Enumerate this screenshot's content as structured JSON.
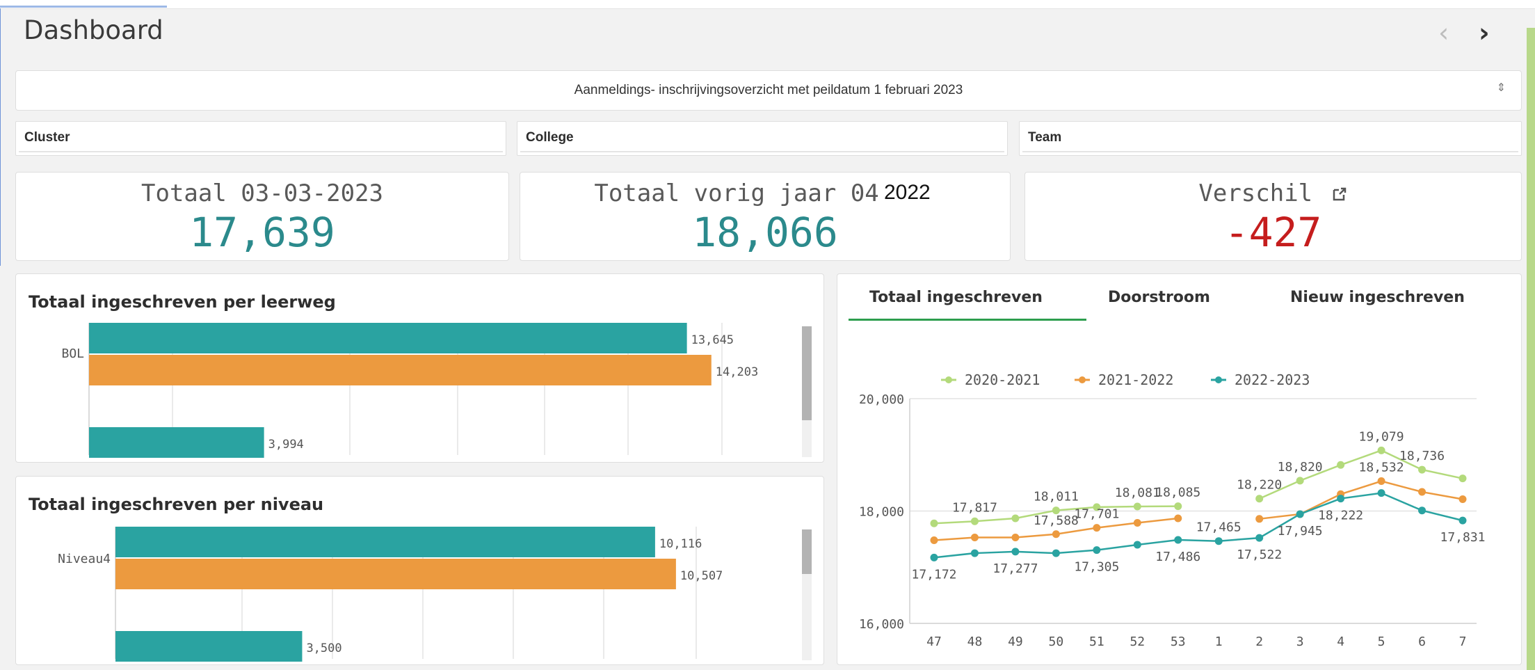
{
  "header": {
    "title": "Dashboard",
    "prev_icon": "‹",
    "next_icon": "›"
  },
  "sheet_selector": {
    "label": "Aanmeldings- inschrijvingsoverzicht met peildatum 1 februari 2023",
    "spin_icon": "⇕"
  },
  "filters": [
    {
      "label": "Cluster"
    },
    {
      "label": "College"
    },
    {
      "label": "Team"
    }
  ],
  "kpis": [
    {
      "title": "Totaal 03-03-2023",
      "value": "17,639"
    },
    {
      "title": "Totaal vorig jaar 04-03-",
      "value": "18,066",
      "overlay": "2022"
    },
    {
      "title": "Verschil",
      "value": "-427",
      "icon": "external-link-icon"
    }
  ],
  "colors": {
    "teal": "#2aa3a1",
    "orange": "#ec9a3f",
    "lightgreen": "#b3da7b",
    "negative": "#c51d1d",
    "accent": "#2d9e4e"
  },
  "bar_leerweg": {
    "title": "Totaal ingeschreven per leerweg",
    "category": "BOL",
    "bars": [
      {
        "label": "13,645",
        "value": 13645,
        "color": "#2aa3a1"
      },
      {
        "label": "14,203",
        "value": 14203,
        "color": "#ec9a3f"
      },
      {
        "label": "3,994",
        "value": 3994,
        "color": "#2aa3a1"
      }
    ]
  },
  "bar_niveau": {
    "title": "Totaal ingeschreven per niveau",
    "category": "Niveau4",
    "bars": [
      {
        "label": "10,116",
        "value": 10116,
        "color": "#2aa3a1"
      },
      {
        "label": "10,507",
        "value": 10507,
        "color": "#ec9a3f"
      },
      {
        "label": "3,500",
        "value": 3500,
        "color": "#2aa3a1"
      }
    ]
  },
  "tabs": [
    {
      "label": "Totaal ingeschreven",
      "active": true
    },
    {
      "label": "Doorstroom",
      "active": false
    },
    {
      "label": "Nieuw ingeschreven",
      "active": false
    }
  ],
  "chart_data": {
    "type": "line",
    "categories": [
      "47",
      "48",
      "49",
      "50",
      "51",
      "52",
      "53",
      "1",
      "2",
      "3",
      "4",
      "5",
      "6",
      "7"
    ],
    "ylim": [
      16000,
      20000
    ],
    "yticks": [
      "16,000",
      "18,000",
      "20,000"
    ],
    "legend_position": "top",
    "series": [
      {
        "name": "2020-2021",
        "color": "#b3da7b",
        "values": [
          17780,
          17817,
          17870,
          18011,
          18070,
          18081,
          18085,
          null,
          18220,
          18540,
          18820,
          19079,
          18736,
          18580
        ]
      },
      {
        "name": "2021-2022",
        "color": "#ec9a3f",
        "values": [
          17480,
          17530,
          17530,
          17588,
          17701,
          17790,
          17870,
          null,
          17860,
          17945,
          18300,
          18532,
          18340,
          18210
        ]
      },
      {
        "name": "2022-2023",
        "color": "#2aa3a1",
        "values": [
          17172,
          17250,
          17277,
          17250,
          17305,
          17400,
          17486,
          17465,
          17522,
          17945,
          18222,
          18320,
          18010,
          17831
        ]
      }
    ],
    "annotations": [
      {
        "series": 2,
        "index": 0,
        "label": "17,172",
        "pos": "below"
      },
      {
        "series": 0,
        "index": 1,
        "label": "17,817",
        "pos": "above"
      },
      {
        "series": 2,
        "index": 2,
        "label": "17,277",
        "pos": "below"
      },
      {
        "series": 1,
        "index": 3,
        "label": "17,588",
        "pos": "above"
      },
      {
        "series": 0,
        "index": 3,
        "label": "18,011",
        "pos": "above"
      },
      {
        "series": 1,
        "index": 4,
        "label": "17,701",
        "pos": "above"
      },
      {
        "series": 2,
        "index": 4,
        "label": "17,305",
        "pos": "below"
      },
      {
        "series": 0,
        "index": 5,
        "label": "18,081",
        "pos": "above"
      },
      {
        "series": 0,
        "index": 6,
        "label": "18,085",
        "pos": "above"
      },
      {
        "series": 2,
        "index": 6,
        "label": "17,486",
        "pos": "below"
      },
      {
        "series": 2,
        "index": 7,
        "label": "17,465",
        "pos": "above"
      },
      {
        "series": 0,
        "index": 8,
        "label": "18,220",
        "pos": "above"
      },
      {
        "series": 2,
        "index": 8,
        "label": "17,522",
        "pos": "below"
      },
      {
        "series": 1,
        "index": 9,
        "label": "17,945",
        "pos": "below"
      },
      {
        "series": 0,
        "index": 9,
        "label": "18,820",
        "pos": "above"
      },
      {
        "series": 2,
        "index": 10,
        "label": "18,222",
        "pos": "below"
      },
      {
        "series": 0,
        "index": 11,
        "label": "19,079",
        "pos": "above"
      },
      {
        "series": 1,
        "index": 11,
        "label": "18,532",
        "pos": "above"
      },
      {
        "series": 0,
        "index": 12,
        "label": "18,736",
        "pos": "above"
      },
      {
        "series": 2,
        "index": 13,
        "label": "17,831",
        "pos": "below"
      }
    ]
  }
}
